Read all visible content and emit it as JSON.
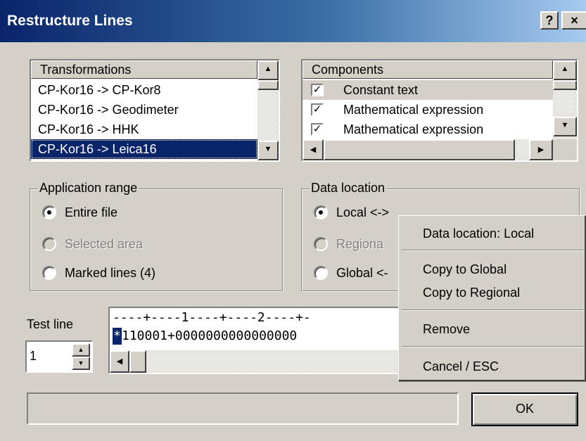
{
  "window": {
    "title": "Restructure Lines",
    "help_label": "?",
    "close_label": "×"
  },
  "transformations": {
    "header": "Transformations",
    "items": [
      "CP-Kor16 -> CP-Kor8",
      "CP-Kor16 -> Geodimeter",
      "CP-Kor16 -> HHK",
      "CP-Kor16 -> Leica16"
    ],
    "selected": "CP-Kor16 -> Leica16"
  },
  "components": {
    "header": "Components",
    "items": [
      {
        "label": "Constant text",
        "checked": true
      },
      {
        "label": "Mathematical expression",
        "checked": true
      },
      {
        "label": "Mathematical expression",
        "checked": true
      }
    ]
  },
  "application_range": {
    "legend": "Application range",
    "options": [
      {
        "label": "Entire file",
        "selected": true,
        "enabled": true
      },
      {
        "label": "Selected area",
        "selected": false,
        "enabled": false
      },
      {
        "label": "Marked lines (4)",
        "selected": false,
        "enabled": true
      }
    ]
  },
  "data_location": {
    "legend": "Data location",
    "options": [
      {
        "label": "Local <->",
        "selected": true,
        "enabled": true
      },
      {
        "label": "Regiona",
        "selected": false,
        "enabled": false
      },
      {
        "label": "Global <-",
        "selected": false,
        "enabled": true
      }
    ]
  },
  "test_line": {
    "label": "Test line",
    "value": "1",
    "ruler": "----+----1----+----2----+-",
    "cursor_char": "*",
    "content": "110001+0000000000000000"
  },
  "context_menu": {
    "items": [
      "Data location: Local",
      "Copy to Global",
      "Copy to Regional",
      "Remove",
      "Cancel / ESC"
    ]
  },
  "status": {
    "text": ""
  },
  "ok_label": "OK"
}
